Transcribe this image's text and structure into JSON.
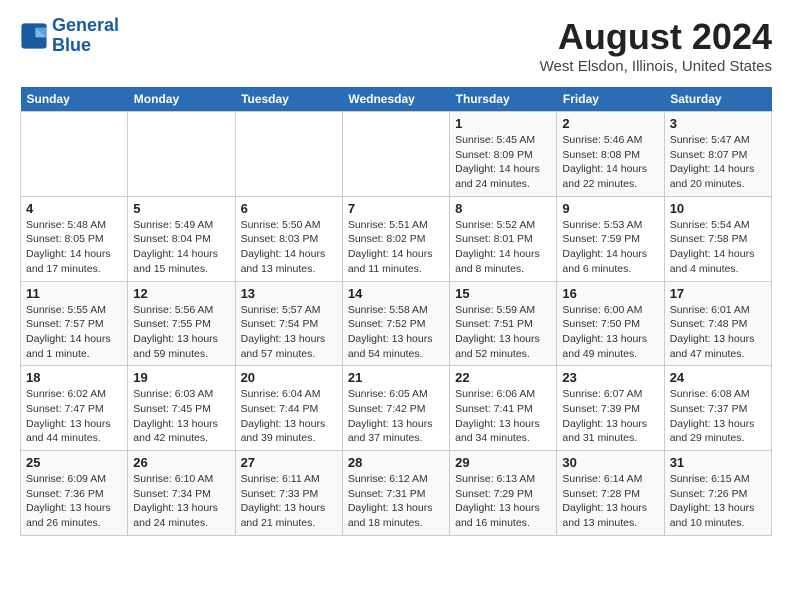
{
  "header": {
    "logo_line1": "General",
    "logo_line2": "Blue",
    "month_year": "August 2024",
    "location": "West Elsdon, Illinois, United States"
  },
  "weekdays": [
    "Sunday",
    "Monday",
    "Tuesday",
    "Wednesday",
    "Thursday",
    "Friday",
    "Saturday"
  ],
  "weeks": [
    [
      {
        "day": "",
        "info": ""
      },
      {
        "day": "",
        "info": ""
      },
      {
        "day": "",
        "info": ""
      },
      {
        "day": "",
        "info": ""
      },
      {
        "day": "1",
        "info": "Sunrise: 5:45 AM\nSunset: 8:09 PM\nDaylight: 14 hours and 24 minutes."
      },
      {
        "day": "2",
        "info": "Sunrise: 5:46 AM\nSunset: 8:08 PM\nDaylight: 14 hours and 22 minutes."
      },
      {
        "day": "3",
        "info": "Sunrise: 5:47 AM\nSunset: 8:07 PM\nDaylight: 14 hours and 20 minutes."
      }
    ],
    [
      {
        "day": "4",
        "info": "Sunrise: 5:48 AM\nSunset: 8:05 PM\nDaylight: 14 hours and 17 minutes."
      },
      {
        "day": "5",
        "info": "Sunrise: 5:49 AM\nSunset: 8:04 PM\nDaylight: 14 hours and 15 minutes."
      },
      {
        "day": "6",
        "info": "Sunrise: 5:50 AM\nSunset: 8:03 PM\nDaylight: 14 hours and 13 minutes."
      },
      {
        "day": "7",
        "info": "Sunrise: 5:51 AM\nSunset: 8:02 PM\nDaylight: 14 hours and 11 minutes."
      },
      {
        "day": "8",
        "info": "Sunrise: 5:52 AM\nSunset: 8:01 PM\nDaylight: 14 hours and 8 minutes."
      },
      {
        "day": "9",
        "info": "Sunrise: 5:53 AM\nSunset: 7:59 PM\nDaylight: 14 hours and 6 minutes."
      },
      {
        "day": "10",
        "info": "Sunrise: 5:54 AM\nSunset: 7:58 PM\nDaylight: 14 hours and 4 minutes."
      }
    ],
    [
      {
        "day": "11",
        "info": "Sunrise: 5:55 AM\nSunset: 7:57 PM\nDaylight: 14 hours and 1 minute."
      },
      {
        "day": "12",
        "info": "Sunrise: 5:56 AM\nSunset: 7:55 PM\nDaylight: 13 hours and 59 minutes."
      },
      {
        "day": "13",
        "info": "Sunrise: 5:57 AM\nSunset: 7:54 PM\nDaylight: 13 hours and 57 minutes."
      },
      {
        "day": "14",
        "info": "Sunrise: 5:58 AM\nSunset: 7:52 PM\nDaylight: 13 hours and 54 minutes."
      },
      {
        "day": "15",
        "info": "Sunrise: 5:59 AM\nSunset: 7:51 PM\nDaylight: 13 hours and 52 minutes."
      },
      {
        "day": "16",
        "info": "Sunrise: 6:00 AM\nSunset: 7:50 PM\nDaylight: 13 hours and 49 minutes."
      },
      {
        "day": "17",
        "info": "Sunrise: 6:01 AM\nSunset: 7:48 PM\nDaylight: 13 hours and 47 minutes."
      }
    ],
    [
      {
        "day": "18",
        "info": "Sunrise: 6:02 AM\nSunset: 7:47 PM\nDaylight: 13 hours and 44 minutes."
      },
      {
        "day": "19",
        "info": "Sunrise: 6:03 AM\nSunset: 7:45 PM\nDaylight: 13 hours and 42 minutes."
      },
      {
        "day": "20",
        "info": "Sunrise: 6:04 AM\nSunset: 7:44 PM\nDaylight: 13 hours and 39 minutes."
      },
      {
        "day": "21",
        "info": "Sunrise: 6:05 AM\nSunset: 7:42 PM\nDaylight: 13 hours and 37 minutes."
      },
      {
        "day": "22",
        "info": "Sunrise: 6:06 AM\nSunset: 7:41 PM\nDaylight: 13 hours and 34 minutes."
      },
      {
        "day": "23",
        "info": "Sunrise: 6:07 AM\nSunset: 7:39 PM\nDaylight: 13 hours and 31 minutes."
      },
      {
        "day": "24",
        "info": "Sunrise: 6:08 AM\nSunset: 7:37 PM\nDaylight: 13 hours and 29 minutes."
      }
    ],
    [
      {
        "day": "25",
        "info": "Sunrise: 6:09 AM\nSunset: 7:36 PM\nDaylight: 13 hours and 26 minutes."
      },
      {
        "day": "26",
        "info": "Sunrise: 6:10 AM\nSunset: 7:34 PM\nDaylight: 13 hours and 24 minutes."
      },
      {
        "day": "27",
        "info": "Sunrise: 6:11 AM\nSunset: 7:33 PM\nDaylight: 13 hours and 21 minutes."
      },
      {
        "day": "28",
        "info": "Sunrise: 6:12 AM\nSunset: 7:31 PM\nDaylight: 13 hours and 18 minutes."
      },
      {
        "day": "29",
        "info": "Sunrise: 6:13 AM\nSunset: 7:29 PM\nDaylight: 13 hours and 16 minutes."
      },
      {
        "day": "30",
        "info": "Sunrise: 6:14 AM\nSunset: 7:28 PM\nDaylight: 13 hours and 13 minutes."
      },
      {
        "day": "31",
        "info": "Sunrise: 6:15 AM\nSunset: 7:26 PM\nDaylight: 13 hours and 10 minutes."
      }
    ]
  ]
}
